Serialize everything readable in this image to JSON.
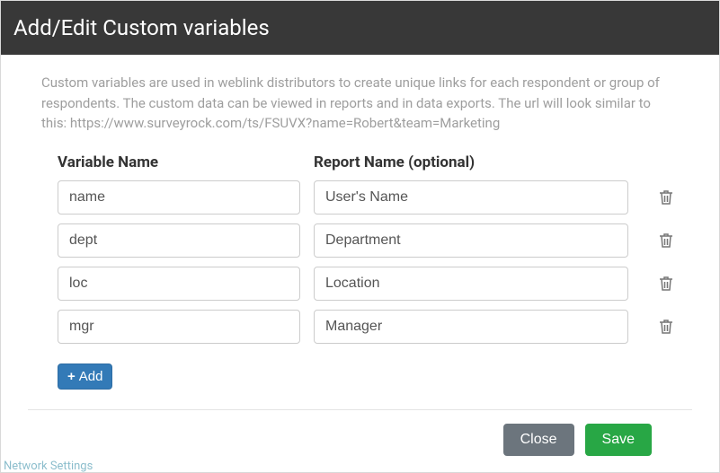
{
  "modal": {
    "title": "Add/Edit Custom variables",
    "description": "Custom variables are used in weblink distributors to create unique links for each respondent or group of respondents. The custom data can be viewed in reports and in data exports. The url will look similar to this: https://www.surveyrock.com/ts/FSUVX?name=Robert&team=Marketing",
    "col_variable": "Variable Name",
    "col_report": "Report Name (optional)",
    "rows": [
      {
        "var": "name",
        "rep": "User's Name"
      },
      {
        "var": "dept",
        "rep": "Department"
      },
      {
        "var": "loc",
        "rep": "Location"
      },
      {
        "var": "mgr",
        "rep": "Manager"
      }
    ],
    "add_label": "Add",
    "close_label": "Close",
    "save_label": "Save"
  },
  "bg_hint": "Network Settings"
}
